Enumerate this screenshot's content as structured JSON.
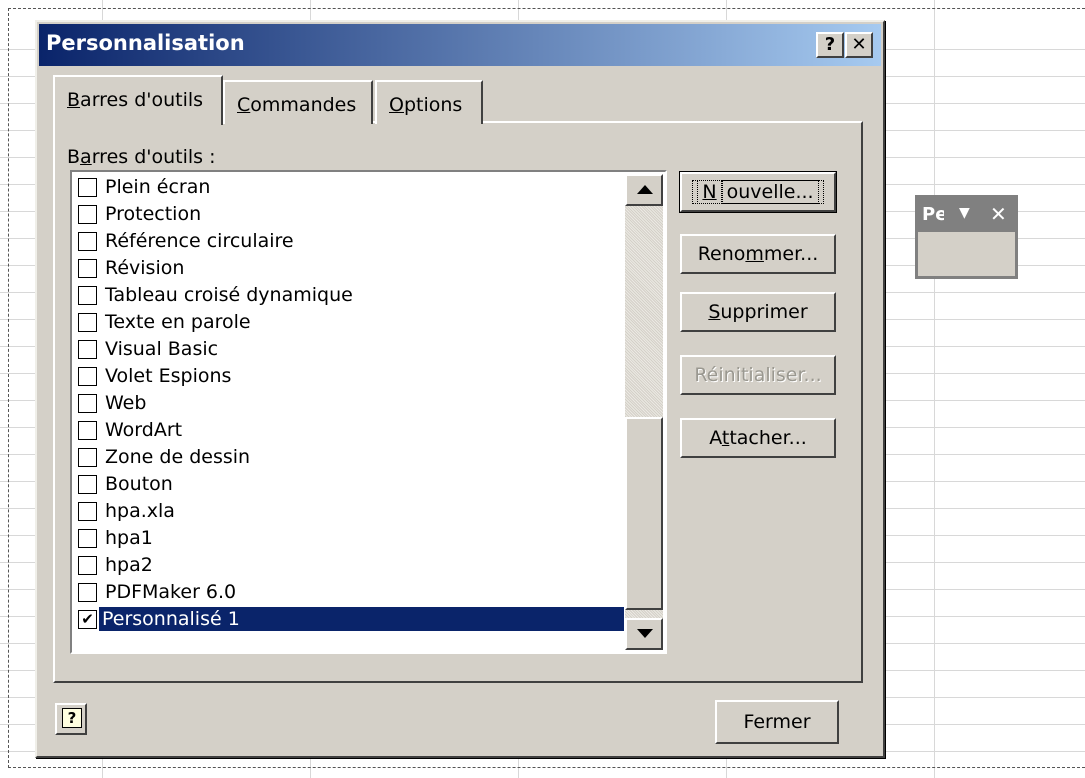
{
  "dialog": {
    "title": "Personnalisation",
    "help_title_btn": "?",
    "close_title_btn": "✕",
    "tabs": [
      {
        "pre": "",
        "key": "B",
        "post": "arres d'outils"
      },
      {
        "pre": "",
        "key": "C",
        "post": "ommandes"
      },
      {
        "pre": "",
        "key": "O",
        "post": "ptions"
      }
    ],
    "list_label": {
      "pre": "B",
      "key": "a",
      "post": "rres d'outils :"
    },
    "toolbars": [
      {
        "label": "Plein écran",
        "checked": false
      },
      {
        "label": "Protection",
        "checked": false
      },
      {
        "label": "Référence circulaire",
        "checked": false
      },
      {
        "label": "Révision",
        "checked": false
      },
      {
        "label": "Tableau croisé dynamique",
        "checked": false
      },
      {
        "label": "Texte en parole",
        "checked": false
      },
      {
        "label": "Visual Basic",
        "checked": false
      },
      {
        "label": "Volet Espions",
        "checked": false
      },
      {
        "label": "Web",
        "checked": false
      },
      {
        "label": "WordArt",
        "checked": false
      },
      {
        "label": "Zone de dessin",
        "checked": false
      },
      {
        "label": "Bouton",
        "checked": false
      },
      {
        "label": "hpa.xla",
        "checked": false
      },
      {
        "label": "hpa1",
        "checked": false
      },
      {
        "label": "hpa2",
        "checked": false
      },
      {
        "label": "PDFMaker 6.0",
        "checked": false
      },
      {
        "label": "Personnalisé 1",
        "checked": true,
        "selected": true
      }
    ],
    "buttons": {
      "new": {
        "pre": "",
        "key": "N",
        "post": "ouvelle..."
      },
      "rename": {
        "pre": "Reno",
        "key": "m",
        "post": "mer..."
      },
      "delete": {
        "pre": "",
        "key": "S",
        "post": "upprimer"
      },
      "reset": "Réinitialiser...",
      "attach": {
        "pre": "A",
        "key": "t",
        "post": "tacher..."
      },
      "close": "Fermer"
    },
    "help_icon": "?"
  },
  "floating_toolbar": {
    "title": "Pe",
    "dropdown": "▼",
    "close": "✕"
  }
}
